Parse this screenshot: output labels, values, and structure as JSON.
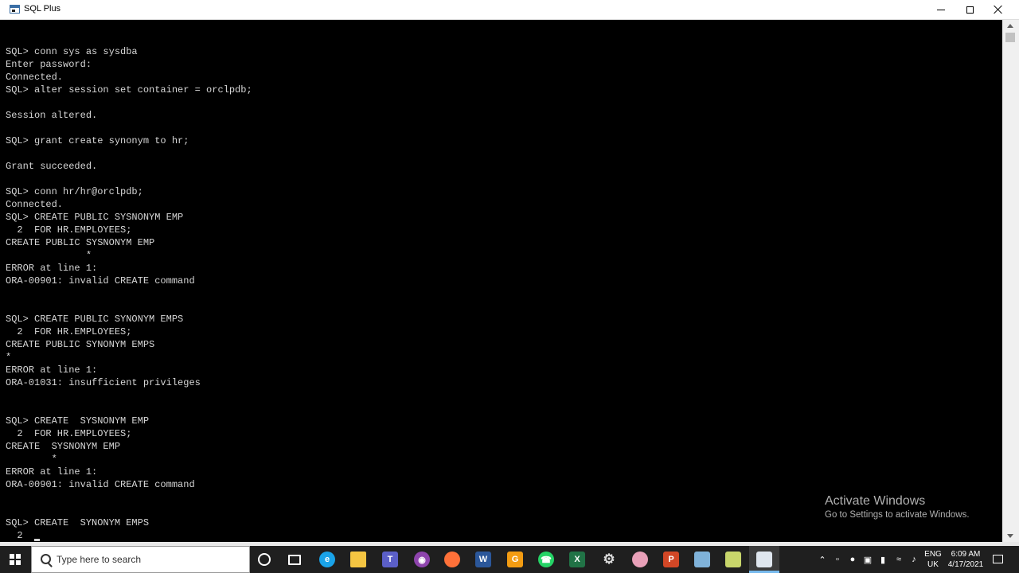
{
  "window": {
    "title": "SQL Plus"
  },
  "console": {
    "text": "SQL> conn sys as sysdba\nEnter password:\nConnected.\nSQL> alter session set container = orclpdb;\n\nSession altered.\n\nSQL> grant create synonym to hr;\n\nGrant succeeded.\n\nSQL> conn hr/hr@orclpdb;\nConnected.\nSQL> CREATE PUBLIC SYSNONYM EMP\n  2  FOR HR.EMPLOYEES;\nCREATE PUBLIC SYSNONYM EMP\n              *\nERROR at line 1:\nORA-00901: invalid CREATE command\n\n\nSQL> CREATE PUBLIC SYNONYM EMPS\n  2  FOR HR.EMPLOYEES;\nCREATE PUBLIC SYNONYM EMPS\n*\nERROR at line 1:\nORA-01031: insufficient privileges\n\n\nSQL> CREATE  SYSNONYM EMP\n  2  FOR HR.EMPLOYEES;\nCREATE  SYSNONYM EMP\n        *\nERROR at line 1:\nORA-00901: invalid CREATE command\n\n\nSQL> CREATE  SYNONYM EMPS\n  2"
  },
  "watermark": {
    "title": "Activate Windows",
    "subtitle": "Go to Settings to activate Windows."
  },
  "taskbar": {
    "search_placeholder": "Type here to search",
    "lang_line1": "ENG",
    "lang_line2": "UK",
    "time": "6:09 AM",
    "date": "4/17/2021",
    "icons": {
      "edge": "e",
      "teams": "T",
      "chrome": "◉",
      "word": "W",
      "orange": "G",
      "whatsapp": "☎",
      "excel": "X",
      "gear": "⚙",
      "ppt": "P"
    }
  }
}
